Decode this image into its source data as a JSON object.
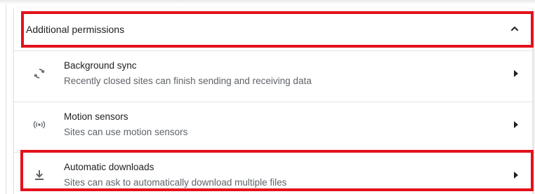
{
  "section": {
    "title": "Additional permissions",
    "expanded": true
  },
  "items": [
    {
      "title": "Background sync",
      "description": "Recently closed sites can finish sending and receiving data",
      "icon": "sync-icon"
    },
    {
      "title": "Motion sensors",
      "description": "Sites can use motion sensors",
      "icon": "motion-sensors-icon"
    },
    {
      "title": "Automatic downloads",
      "description": "Sites can ask to automatically download multiple files",
      "icon": "download-icon"
    }
  ],
  "colors": {
    "highlight": "#e3121b",
    "text_primary": "#202124",
    "text_secondary": "#5f6368"
  }
}
